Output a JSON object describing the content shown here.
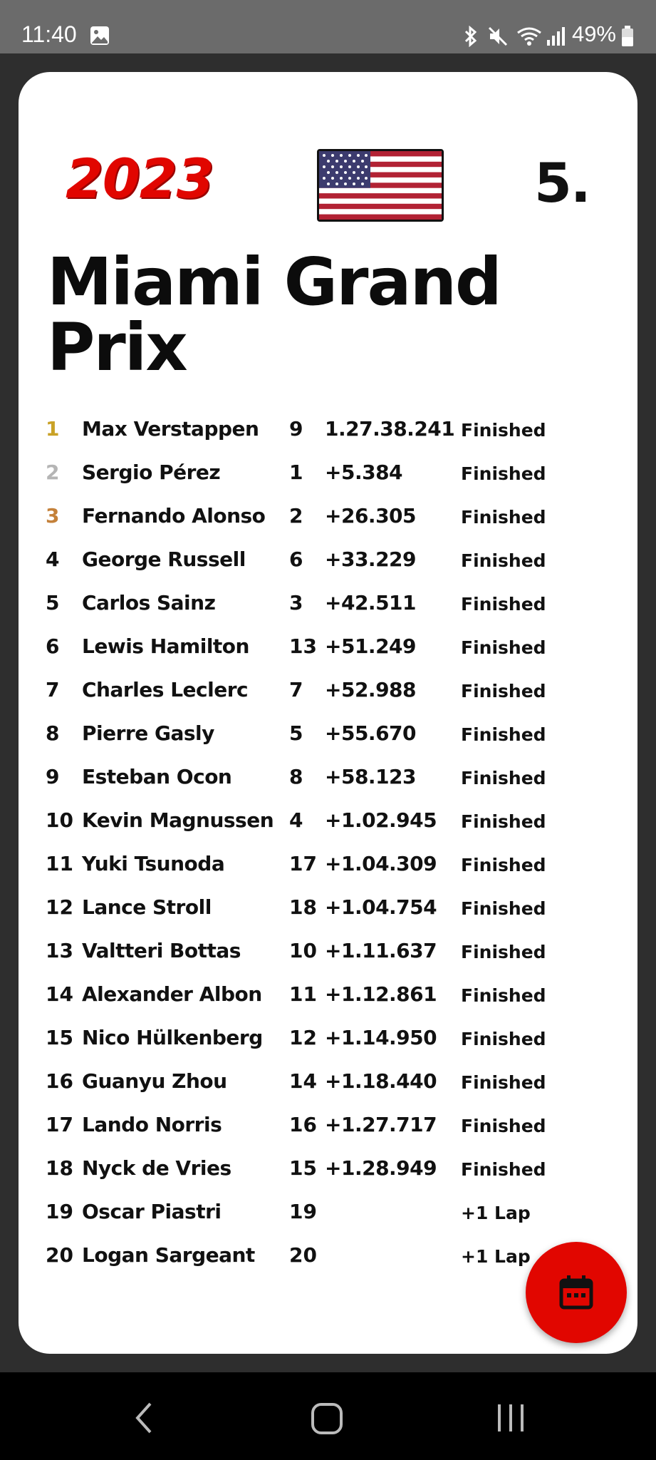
{
  "status_bar": {
    "time": "11:40",
    "battery": "49%",
    "icons": [
      "image-icon",
      "bluetooth-icon",
      "mute-icon",
      "wifi-icon",
      "signal-icon",
      "battery-icon"
    ]
  },
  "race": {
    "year": "2023",
    "round": "5.",
    "title": "Miami Grand Prix",
    "flag": "usa-flag"
  },
  "colors": {
    "accent": "#e10600",
    "gold": "#c9a227",
    "silver": "#b5b5b5",
    "bronze": "#c4813a"
  },
  "results": [
    {
      "pos": "1",
      "driver": "Max Verstappen",
      "grid": "9",
      "time": "1.27.38.241",
      "status": "Finished"
    },
    {
      "pos": "2",
      "driver": "Sergio Pérez",
      "grid": "1",
      "time": "+5.384",
      "status": "Finished"
    },
    {
      "pos": "3",
      "driver": "Fernando Alonso",
      "grid": "2",
      "time": "+26.305",
      "status": "Finished"
    },
    {
      "pos": "4",
      "driver": "George Russell",
      "grid": "6",
      "time": "+33.229",
      "status": "Finished"
    },
    {
      "pos": "5",
      "driver": "Carlos Sainz",
      "grid": "3",
      "time": "+42.511",
      "status": "Finished"
    },
    {
      "pos": "6",
      "driver": "Lewis Hamilton",
      "grid": "13",
      "time": "+51.249",
      "status": "Finished"
    },
    {
      "pos": "7",
      "driver": "Charles Leclerc",
      "grid": "7",
      "time": "+52.988",
      "status": "Finished"
    },
    {
      "pos": "8",
      "driver": "Pierre Gasly",
      "grid": "5",
      "time": "+55.670",
      "status": "Finished"
    },
    {
      "pos": "9",
      "driver": "Esteban Ocon",
      "grid": "8",
      "time": "+58.123",
      "status": "Finished"
    },
    {
      "pos": "10",
      "driver": "Kevin Magnussen",
      "grid": "4",
      "time": "+1.02.945",
      "status": "Finished"
    },
    {
      "pos": "11",
      "driver": "Yuki Tsunoda",
      "grid": "17",
      "time": "+1.04.309",
      "status": "Finished"
    },
    {
      "pos": "12",
      "driver": "Lance Stroll",
      "grid": "18",
      "time": "+1.04.754",
      "status": "Finished"
    },
    {
      "pos": "13",
      "driver": "Valtteri Bottas",
      "grid": "10",
      "time": "+1.11.637",
      "status": "Finished"
    },
    {
      "pos": "14",
      "driver": "Alexander Albon",
      "grid": "11",
      "time": "+1.12.861",
      "status": "Finished"
    },
    {
      "pos": "15",
      "driver": "Nico Hülkenberg",
      "grid": "12",
      "time": "+1.14.950",
      "status": "Finished"
    },
    {
      "pos": "16",
      "driver": "Guanyu Zhou",
      "grid": "14",
      "time": "+1.18.440",
      "status": "Finished"
    },
    {
      "pos": "17",
      "driver": "Lando Norris",
      "grid": "16",
      "time": "+1.27.717",
      "status": "Finished"
    },
    {
      "pos": "18",
      "driver": "Nyck de Vries",
      "grid": "15",
      "time": "+1.28.949",
      "status": "Finished"
    },
    {
      "pos": "19",
      "driver": "Oscar Piastri",
      "grid": "19",
      "time": "",
      "status": "+1 Lap"
    },
    {
      "pos": "20",
      "driver": "Logan Sargeant",
      "grid": "20",
      "time": "",
      "status": "+1 Lap"
    }
  ],
  "fab": {
    "icon": "calendar-icon"
  },
  "nav_bar": {
    "buttons": [
      "back-icon",
      "home-icon",
      "recents-icon"
    ]
  }
}
